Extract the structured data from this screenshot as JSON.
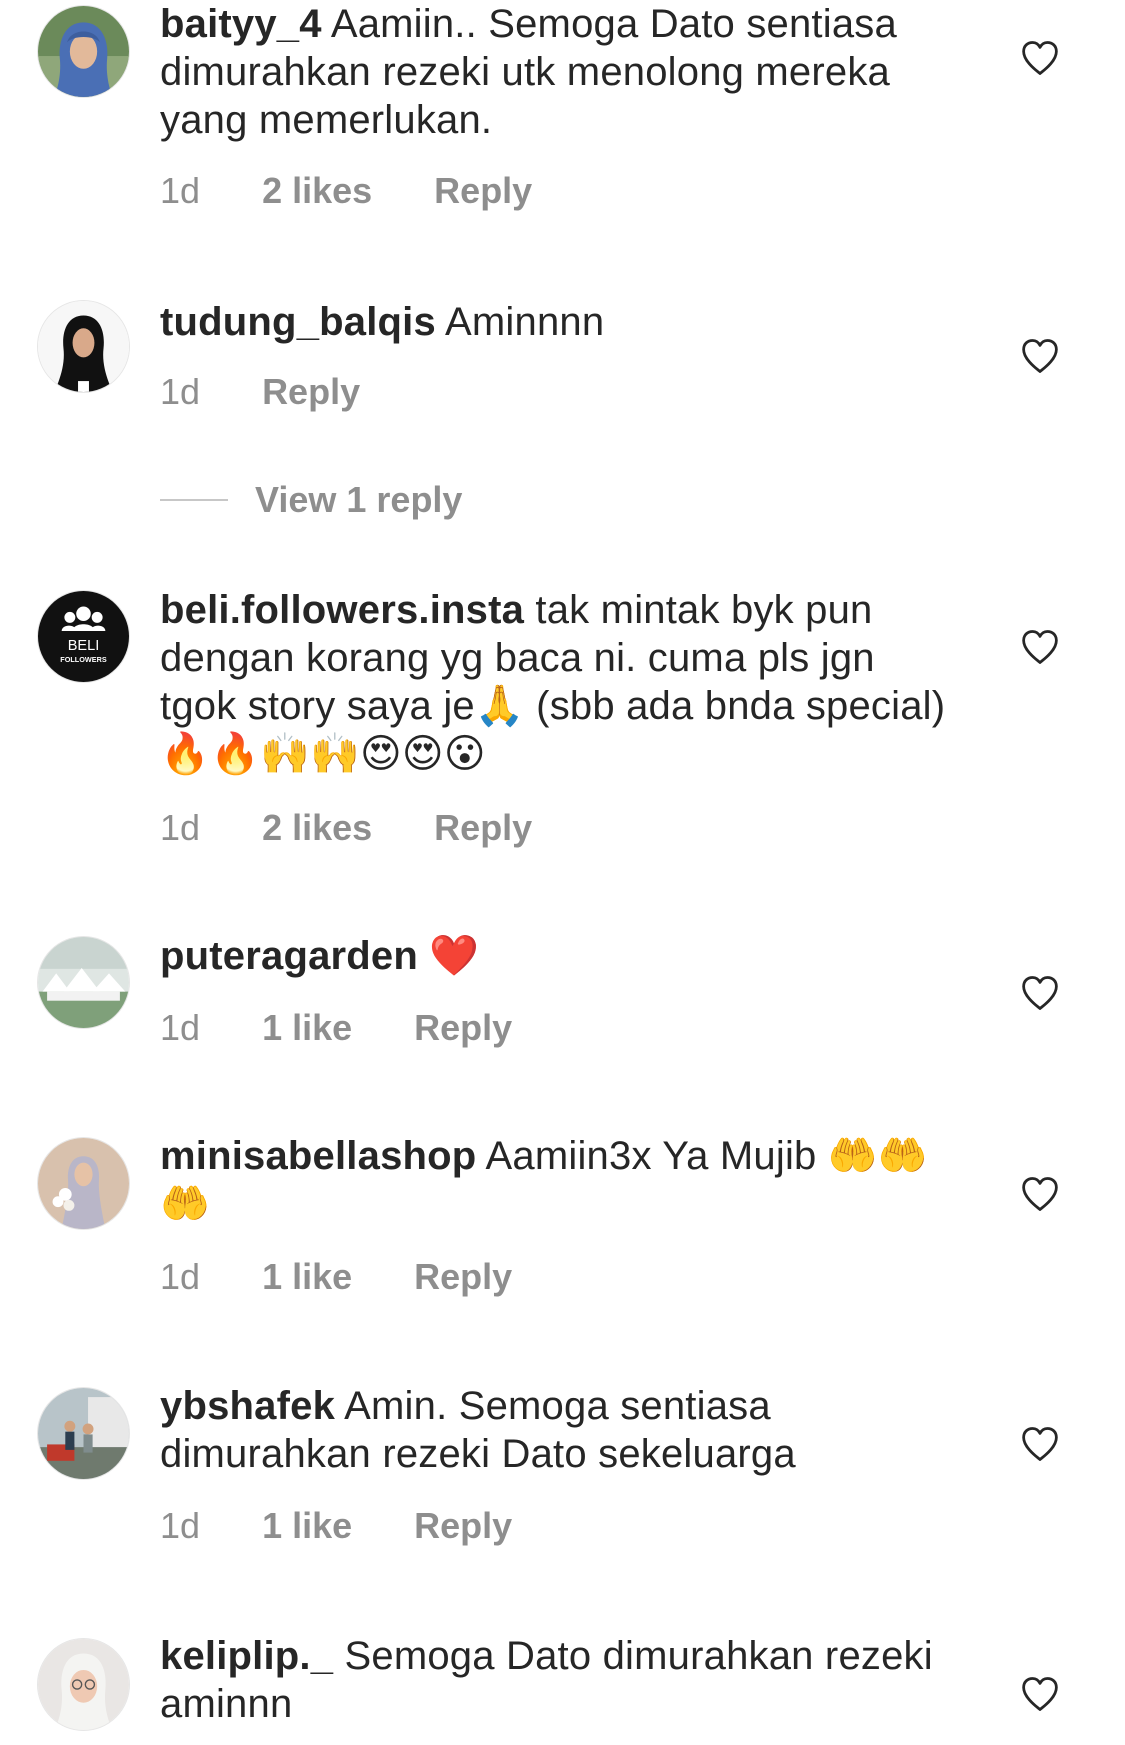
{
  "comments": [
    {
      "username": "baityy_4",
      "text": "Aamiin.. Semoga Dato sentiasa dimurahkan rezeki utk menolong mereka yang memerlukan.",
      "time": "1d",
      "likes": "2 likes",
      "reply": "Reply",
      "avatar_icon": "user-hijab-blue-avatar"
    },
    {
      "username": "tudung_balqis",
      "text": "Aminnnn",
      "time": "1d",
      "likes": "",
      "reply": "Reply",
      "avatar_icon": "user-hijab-black-avatar",
      "view_replies": "View 1 reply"
    },
    {
      "username": "beli.followers.insta",
      "text": "tak mintak byk pun dengan korang yg baca ni. cuma pls jgn tgok story saya je🙏 (sbb ada bnda special) 🔥🔥🙌🙌😍😍😮",
      "time": "1d",
      "likes": "2 likes",
      "reply": "Reply",
      "avatar_icon": "beli-followers-logo",
      "avatar_text": "BELI",
      "avatar_subtext": "FOLLOWERS"
    },
    {
      "username": "puteragarden",
      "text": "❤️",
      "time": "1d",
      "likes": "1 like",
      "reply": "Reply",
      "avatar_icon": "garden-tents-avatar"
    },
    {
      "username": "minisabellashop",
      "text": "Aamiin3x Ya Mujib 🤲🤲🤲",
      "time": "1d",
      "likes": "1 like",
      "reply": "Reply",
      "avatar_icon": "bride-flowers-avatar"
    },
    {
      "username": "ybshafek",
      "text": "Amin. Semoga sentiasa dimurahkan rezeki Dato sekeluarga",
      "time": "1d",
      "likes": "1 like",
      "reply": "Reply",
      "avatar_icon": "family-outdoor-avatar"
    },
    {
      "username": "keliplip._",
      "text": "Semoga Dato dimurahkan rezeki aminnn",
      "time": "",
      "likes": "",
      "reply": "",
      "avatar_icon": "user-hijab-glasses-avatar"
    }
  ],
  "colors": {
    "text": "#262626",
    "meta": "#8e8e8e",
    "divider": "#c7c7c7"
  }
}
